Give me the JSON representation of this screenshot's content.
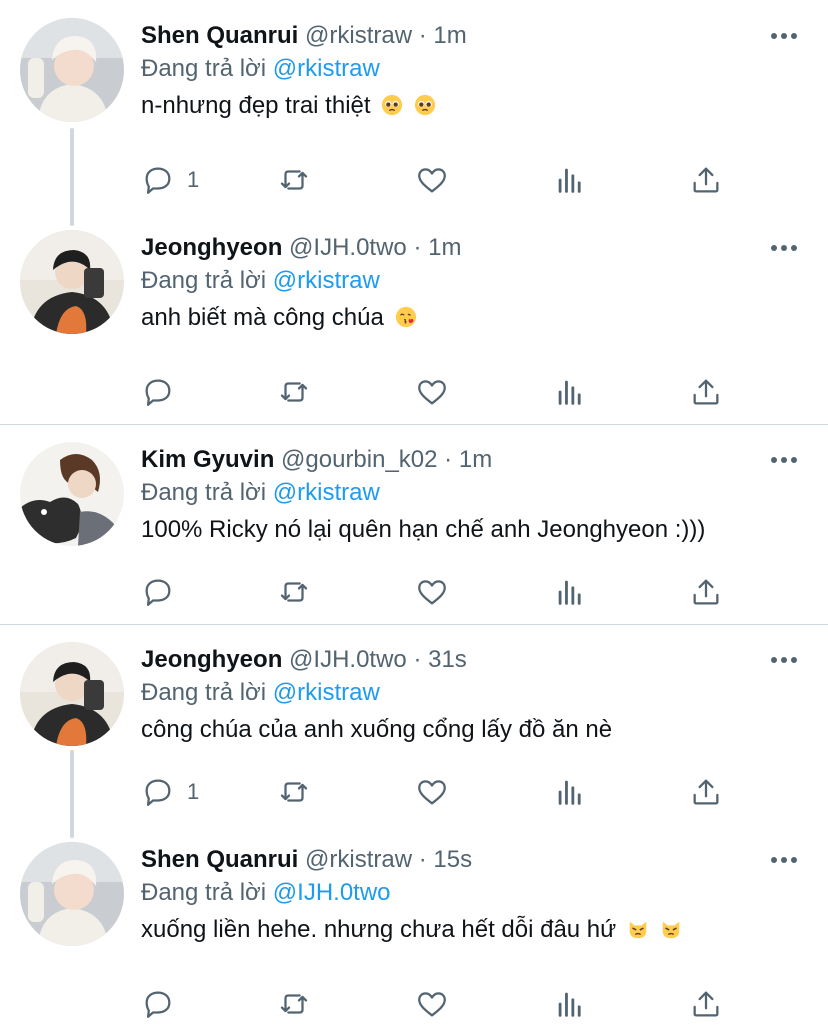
{
  "tweets": [
    {
      "name": "Shen Quanrui",
      "handle": "@rkistraw",
      "time": "1m",
      "replying_prefix": "Đang trả lời",
      "replying_to": "@rkistraw",
      "text": "n-nhưng đẹp trai thiệt",
      "emoji": [
        "pleading-face",
        "pleading-face"
      ],
      "reply_count": "1"
    },
    {
      "name": "Jeonghyeon",
      "handle": "@IJH.0two",
      "time": "1m",
      "replying_prefix": "Đang trả lời",
      "replying_to": "@rkistraw",
      "text": "anh biết mà công chúa",
      "emoji": [
        "face-blowing-kiss"
      ],
      "reply_count": ""
    },
    {
      "name": "Kim Gyuvin",
      "handle": "@gourbin_k02",
      "time": "1m",
      "replying_prefix": "Đang trả lời",
      "replying_to": "@rkistraw",
      "text": "100% Ricky nó lại quên hạn chế anh Jeonghyeon :)))",
      "emoji": [],
      "reply_count": ""
    },
    {
      "name": "Jeonghyeon",
      "handle": "@IJH.0two",
      "time": "31s",
      "replying_prefix": "Đang trả lời",
      "replying_to": "@rkistraw",
      "text": "công chúa của anh xuống cổng lấy đồ ăn nè",
      "emoji": [],
      "reply_count": "1"
    },
    {
      "name": "Shen Quanrui",
      "handle": "@rkistraw",
      "time": "15s",
      "replying_prefix": "Đang trả lời",
      "replying_to": "@IJH.0two",
      "text": "xuống liền hehe. nhưng chưa hết dỗi đâu hứ",
      "emoji": [
        "pouting-cat-face",
        "pouting-cat-face"
      ],
      "reply_count": ""
    }
  ],
  "separator": "·",
  "colors": {
    "link": "#1d9bf0",
    "muted": "#536471",
    "divider": "#cfd9de"
  },
  "icons": [
    "more-icon",
    "reply-icon",
    "retweet-icon",
    "like-icon",
    "views-icon",
    "share-icon"
  ]
}
